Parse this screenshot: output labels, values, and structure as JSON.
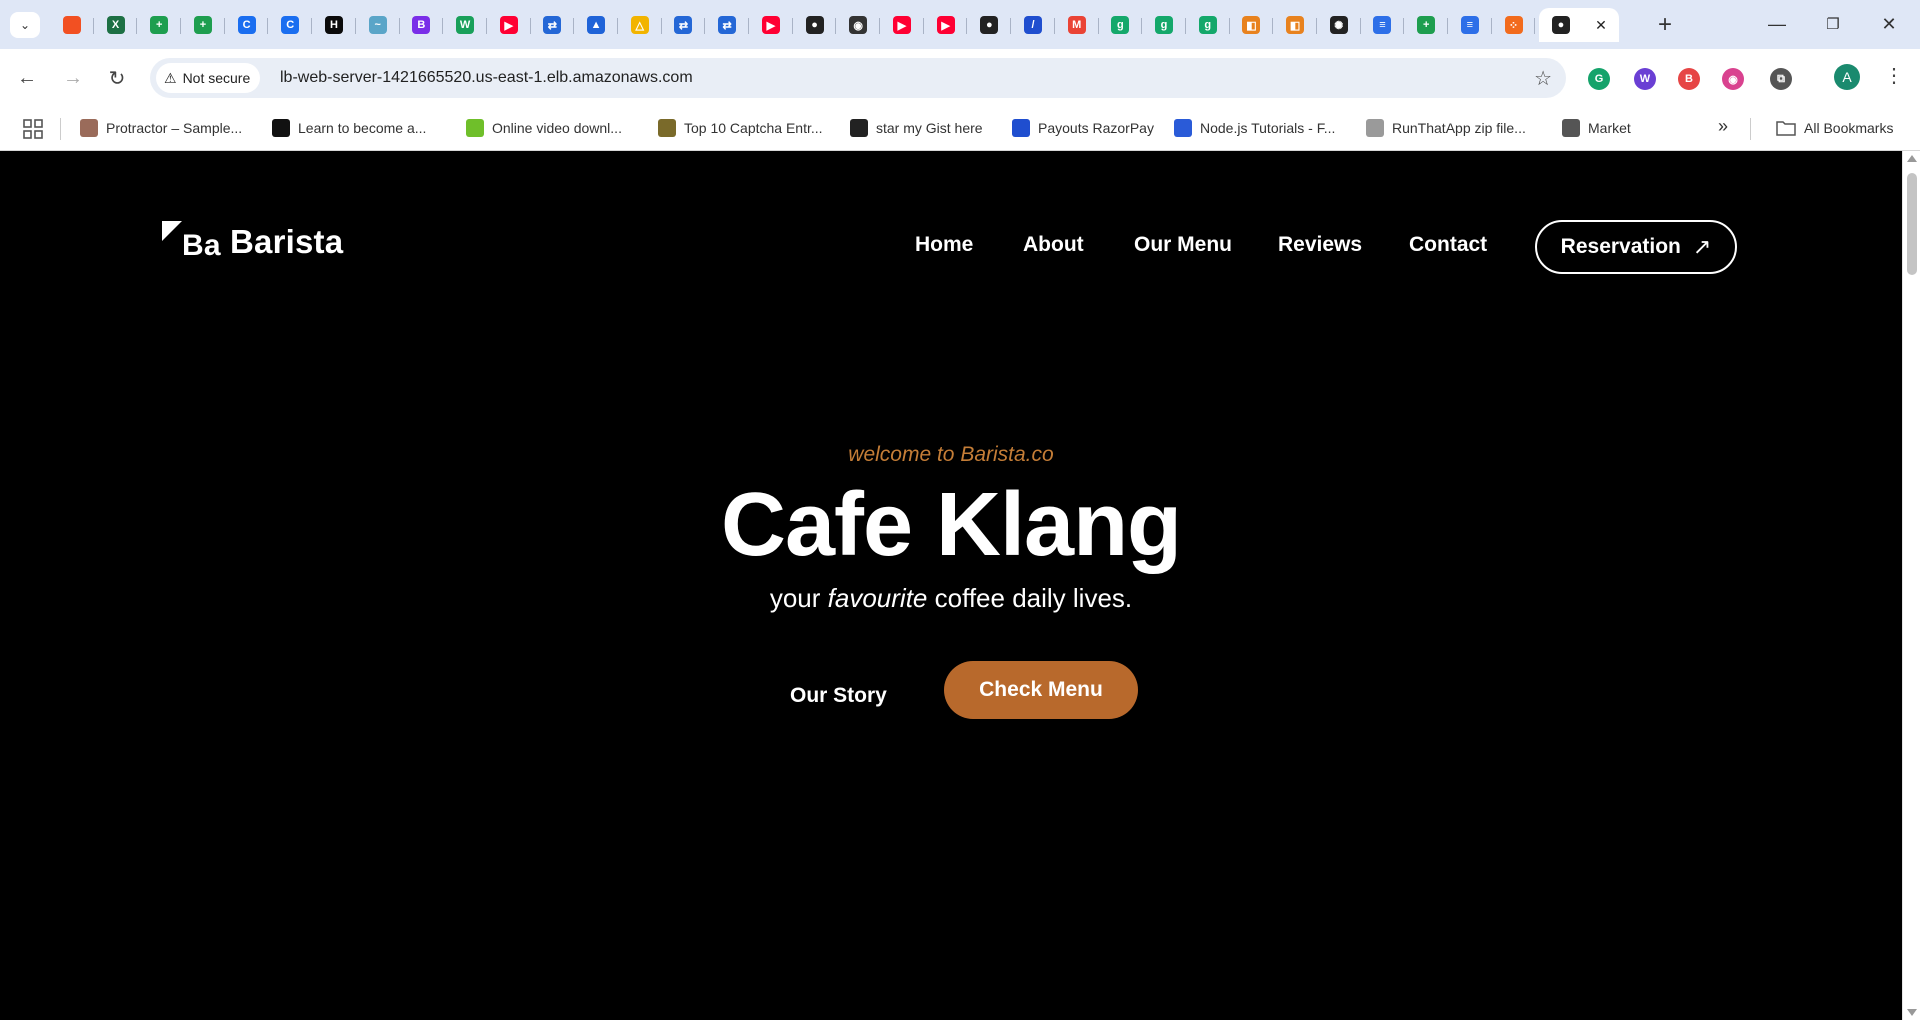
{
  "browser": {
    "tab_favicons": [
      {
        "name": "microsoft-icon",
        "color": "#f25022",
        "glyph": ""
      },
      {
        "name": "excel-icon",
        "color": "#1d7044",
        "glyph": "X"
      },
      {
        "name": "sheets-icon",
        "color": "#1e9e4f",
        "glyph": "+"
      },
      {
        "name": "sheets-icon",
        "color": "#1e9e4f",
        "glyph": "+"
      },
      {
        "name": "c-icon",
        "color": "#1a6ef0",
        "glyph": "C"
      },
      {
        "name": "c-icon",
        "color": "#1a6ef0",
        "glyph": "C"
      },
      {
        "name": "hackerrank-icon",
        "color": "#0b0b0b",
        "glyph": "H"
      },
      {
        "name": "bird-icon",
        "color": "#5aa5c8",
        "glyph": "~"
      },
      {
        "name": "bootstrap-icon",
        "color": "#7a2ee8",
        "glyph": "B"
      },
      {
        "name": "w-icon",
        "color": "#19a05a",
        "glyph": "W"
      },
      {
        "name": "youtube-icon",
        "color": "#ff0033",
        "glyph": "▶"
      },
      {
        "name": "jira-icon",
        "color": "#2467d6",
        "glyph": "⇄"
      },
      {
        "name": "atlassian-icon",
        "color": "#1f63d8",
        "glyph": "▲"
      },
      {
        "name": "drive-icon",
        "color": "#f2b400",
        "glyph": "△"
      },
      {
        "name": "jira-icon",
        "color": "#2467d6",
        "glyph": "⇄"
      },
      {
        "name": "jira-icon",
        "color": "#2467d6",
        "glyph": "⇄"
      },
      {
        "name": "youtube-icon",
        "color": "#ff0033",
        "glyph": "▶"
      },
      {
        "name": "github-icon",
        "color": "#222222",
        "glyph": "●"
      },
      {
        "name": "camera-icon",
        "color": "#333333",
        "glyph": "◉"
      },
      {
        "name": "youtube-icon",
        "color": "#ff0033",
        "glyph": "▶"
      },
      {
        "name": "youtube-icon",
        "color": "#ff0033",
        "glyph": "▶"
      },
      {
        "name": "github-icon",
        "color": "#222222",
        "glyph": "●"
      },
      {
        "name": "razorpay-icon",
        "color": "#1f4ecf",
        "glyph": "/"
      },
      {
        "name": "gmail-icon",
        "color": "#ea4335",
        "glyph": "M"
      },
      {
        "name": "grammarly-icon",
        "color": "#14a86b",
        "glyph": "g"
      },
      {
        "name": "grammarly-icon",
        "color": "#14a86b",
        "glyph": "g"
      },
      {
        "name": "grammarly-icon",
        "color": "#14a86b",
        "glyph": "g"
      },
      {
        "name": "orange-square-icon",
        "color": "#e8821e",
        "glyph": "◧"
      },
      {
        "name": "orange-square-icon",
        "color": "#e8821e",
        "glyph": "◧"
      },
      {
        "name": "chatgpt-icon",
        "color": "#222222",
        "glyph": "✺"
      },
      {
        "name": "docs-icon",
        "color": "#2d6fe8",
        "glyph": "≡"
      },
      {
        "name": "sheets-icon",
        "color": "#1e9e4f",
        "glyph": "+"
      },
      {
        "name": "docs-icon",
        "color": "#2d6fe8",
        "glyph": "≡"
      },
      {
        "name": "figma-dots-icon",
        "color": "#f26b1d",
        "glyph": "⁘"
      }
    ],
    "active_tab": {
      "icon": "github-icon",
      "close_glyph": "✕"
    },
    "new_tab_glyph": "+",
    "window_controls": {
      "minimize": "—",
      "restore": "❐",
      "close": "✕"
    },
    "nav": {
      "back": "←",
      "forward": "→",
      "reload": "↻"
    },
    "security_label": "Not secure",
    "url": "lb-web-server-1421665520.us-east-1.elb.amazonaws.com",
    "bookmark_star": "☆",
    "extensions": [
      {
        "name": "grammarly-extension-icon",
        "color": "#15a36b",
        "glyph": "G"
      },
      {
        "name": "purple-extension-icon",
        "color": "#6a3fd4",
        "glyph": "W"
      },
      {
        "name": "red-extension-icon",
        "color": "#e64545",
        "glyph": "B"
      },
      {
        "name": "color-picker-extension-icon",
        "color": "#d9428f",
        "glyph": "◉"
      },
      {
        "name": "puzzle-extension-icon",
        "color": "#555555",
        "glyph": "⧉"
      }
    ],
    "avatar_letter": "A",
    "menu_glyph": "⋮",
    "bookmarks": [
      {
        "label": "Protractor – Sample...",
        "color": "#9a6b5a"
      },
      {
        "label": "Learn to become a...",
        "color": "#111111"
      },
      {
        "label": "Online video downl...",
        "color": "#6fbf2a"
      },
      {
        "label": "Top 10 Captcha Entr...",
        "color": "#7a6a2a"
      },
      {
        "label": "star my Gist here",
        "color": "#222222"
      },
      {
        "label": "Payouts RazorPay",
        "color": "#1f4ecf"
      },
      {
        "label": "Node.js Tutorials - F...",
        "color": "#2a5bd8"
      },
      {
        "label": "RunThatApp zip file...",
        "color": "#9a9a9a"
      },
      {
        "label": "Market",
        "color": "#555555"
      }
    ],
    "bookmarks_overflow": "»",
    "all_bookmarks": "All Bookmarks"
  },
  "site": {
    "logo_mark": "Ba",
    "logo_text": "Barista",
    "nav": [
      "Home",
      "About",
      "Our Menu",
      "Reviews",
      "Contact"
    ],
    "reservation_label": "Reservation",
    "reservation_arrow": "↗",
    "welcome": "welcome to Barista.co",
    "title": "Cafe Klang",
    "tagline_pre": "your ",
    "tagline_em": "favourite",
    "tagline_post": " coffee daily lives.",
    "our_story": "Our Story",
    "check_menu": "Check Menu",
    "accent_color": "#b8692c"
  }
}
